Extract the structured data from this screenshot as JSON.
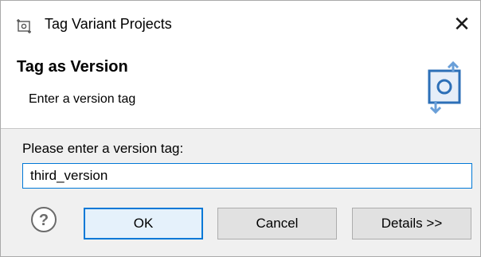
{
  "window": {
    "title": "Tag Variant Projects",
    "close_glyph": "✕",
    "icon": "tag-variant-icon"
  },
  "banner": {
    "heading": "Tag as Version",
    "subtext": "Enter a version tag",
    "icon": "tag-version-wizard-icon"
  },
  "form": {
    "prompt": "Please enter a version tag:",
    "tag_value": "third_version"
  },
  "buttons": {
    "help_icon": "question-icon",
    "ok": "OK",
    "cancel": "Cancel",
    "details": "Details >>"
  },
  "colors": {
    "accent": "#0078d7",
    "icon_blue": "#2c6fb7"
  }
}
